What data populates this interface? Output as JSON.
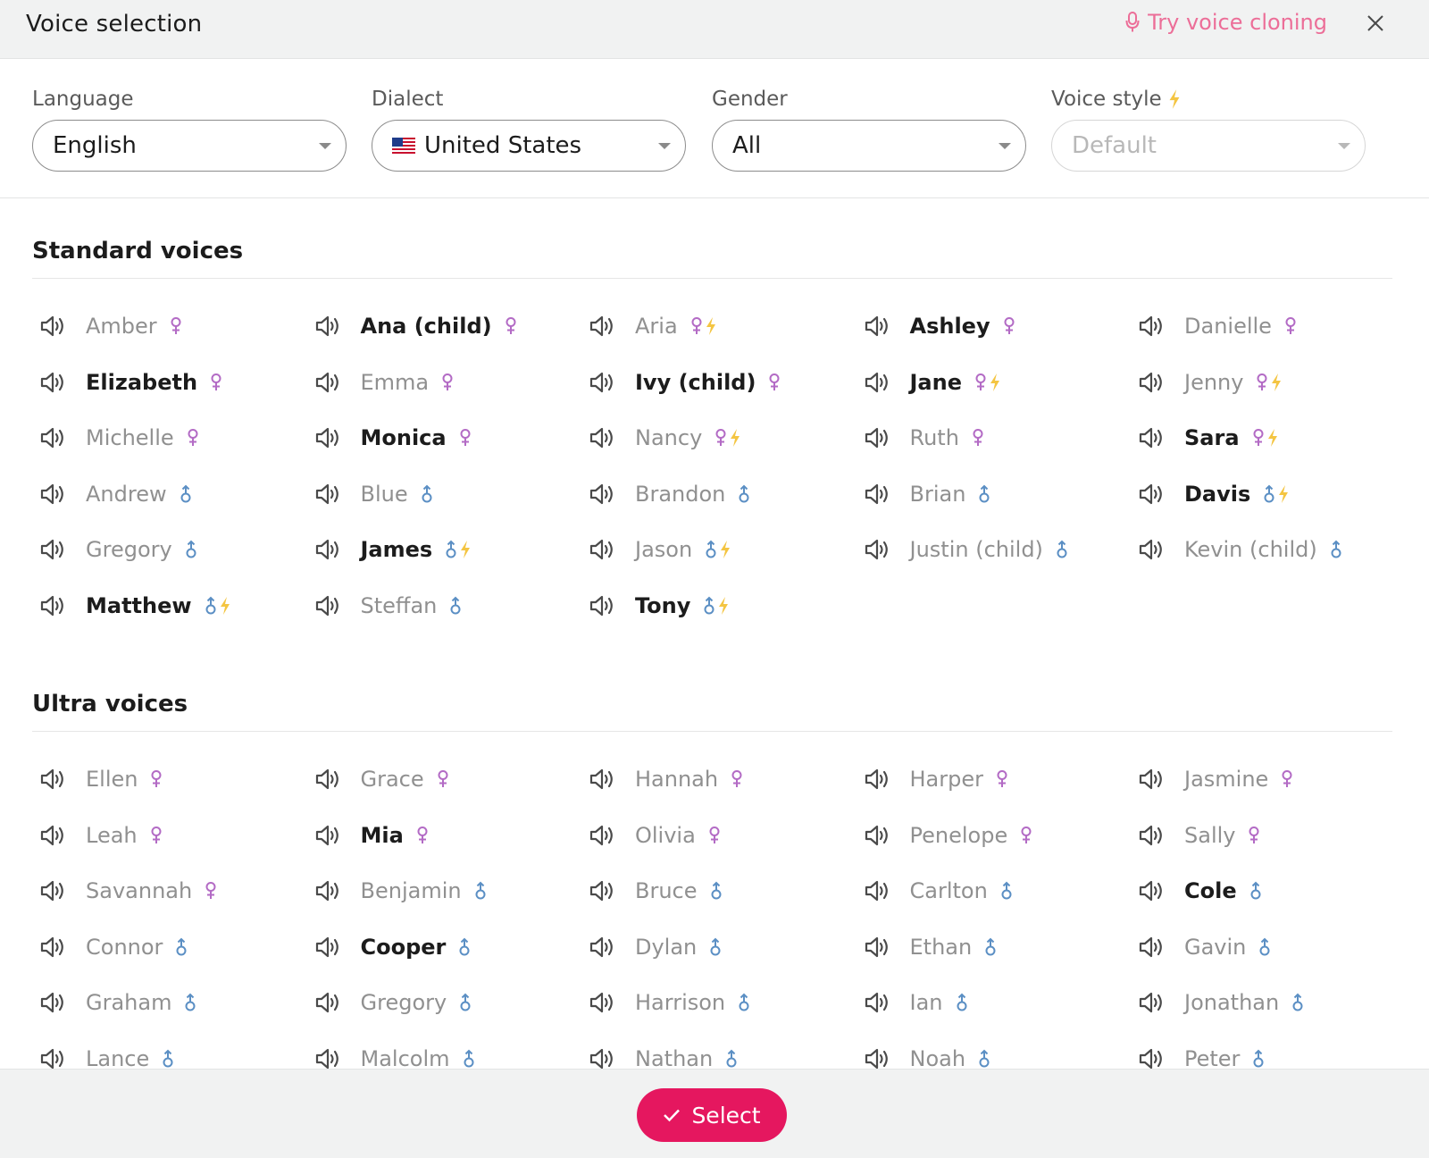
{
  "dialog": {
    "title": "Voice selection",
    "clone_link": "Try voice cloning"
  },
  "filters": {
    "language": {
      "label": "Language",
      "value": "English"
    },
    "dialect": {
      "label": "Dialect",
      "value": "United States"
    },
    "gender": {
      "label": "Gender",
      "value": "All"
    },
    "style": {
      "label": "Voice style",
      "value": "Default",
      "disabled": true
    }
  },
  "sections": [
    {
      "title": "Standard voices",
      "voices": [
        {
          "name": "Amber",
          "gender": "f",
          "style": false,
          "active": false
        },
        {
          "name": "Ana (child)",
          "gender": "f",
          "style": false,
          "active": true
        },
        {
          "name": "Aria",
          "gender": "f",
          "style": true,
          "active": false
        },
        {
          "name": "Ashley",
          "gender": "f",
          "style": false,
          "active": true
        },
        {
          "name": "Danielle",
          "gender": "f",
          "style": false,
          "active": false
        },
        {
          "name": "Elizabeth",
          "gender": "f",
          "style": false,
          "active": true
        },
        {
          "name": "Emma",
          "gender": "f",
          "style": false,
          "active": false
        },
        {
          "name": "Ivy (child)",
          "gender": "f",
          "style": false,
          "active": true
        },
        {
          "name": "Jane",
          "gender": "f",
          "style": true,
          "active": true
        },
        {
          "name": "Jenny",
          "gender": "f",
          "style": true,
          "active": false
        },
        {
          "name": "Michelle",
          "gender": "f",
          "style": false,
          "active": false
        },
        {
          "name": "Monica",
          "gender": "f",
          "style": false,
          "active": true
        },
        {
          "name": "Nancy",
          "gender": "f",
          "style": true,
          "active": false
        },
        {
          "name": "Ruth",
          "gender": "f",
          "style": false,
          "active": false
        },
        {
          "name": "Sara",
          "gender": "f",
          "style": true,
          "active": true
        },
        {
          "name": "Andrew",
          "gender": "m",
          "style": false,
          "active": false
        },
        {
          "name": "Blue",
          "gender": "m",
          "style": false,
          "active": false
        },
        {
          "name": "Brandon",
          "gender": "m",
          "style": false,
          "active": false
        },
        {
          "name": "Brian",
          "gender": "m",
          "style": false,
          "active": false
        },
        {
          "name": "Davis",
          "gender": "m",
          "style": true,
          "active": true
        },
        {
          "name": "Gregory",
          "gender": "m",
          "style": false,
          "active": false
        },
        {
          "name": "James",
          "gender": "m",
          "style": true,
          "active": true
        },
        {
          "name": "Jason",
          "gender": "m",
          "style": true,
          "active": false
        },
        {
          "name": "Justin (child)",
          "gender": "m",
          "style": false,
          "active": false
        },
        {
          "name": "Kevin (child)",
          "gender": "m",
          "style": false,
          "active": false
        },
        {
          "name": "Matthew",
          "gender": "m",
          "style": true,
          "active": true
        },
        {
          "name": "Steffan",
          "gender": "m",
          "style": false,
          "active": false
        },
        {
          "name": "Tony",
          "gender": "m",
          "style": true,
          "active": true
        }
      ]
    },
    {
      "title": "Ultra voices",
      "voices": [
        {
          "name": "Ellen",
          "gender": "f",
          "style": false,
          "active": false
        },
        {
          "name": "Grace",
          "gender": "f",
          "style": false,
          "active": false
        },
        {
          "name": "Hannah",
          "gender": "f",
          "style": false,
          "active": false
        },
        {
          "name": "Harper",
          "gender": "f",
          "style": false,
          "active": false
        },
        {
          "name": "Jasmine",
          "gender": "f",
          "style": false,
          "active": false
        },
        {
          "name": "Leah",
          "gender": "f",
          "style": false,
          "active": false
        },
        {
          "name": "Mia",
          "gender": "f",
          "style": false,
          "active": true
        },
        {
          "name": "Olivia",
          "gender": "f",
          "style": false,
          "active": false
        },
        {
          "name": "Penelope",
          "gender": "f",
          "style": false,
          "active": false
        },
        {
          "name": "Sally",
          "gender": "f",
          "style": false,
          "active": false
        },
        {
          "name": "Savannah",
          "gender": "f",
          "style": false,
          "active": false
        },
        {
          "name": "Benjamin",
          "gender": "m",
          "style": false,
          "active": false
        },
        {
          "name": "Bruce",
          "gender": "m",
          "style": false,
          "active": false
        },
        {
          "name": "Carlton",
          "gender": "m",
          "style": false,
          "active": false
        },
        {
          "name": "Cole",
          "gender": "m",
          "style": false,
          "active": true
        },
        {
          "name": "Connor",
          "gender": "m",
          "style": false,
          "active": false
        },
        {
          "name": "Cooper",
          "gender": "m",
          "style": false,
          "active": true
        },
        {
          "name": "Dylan",
          "gender": "m",
          "style": false,
          "active": false
        },
        {
          "name": "Ethan",
          "gender": "m",
          "style": false,
          "active": false
        },
        {
          "name": "Gavin",
          "gender": "m",
          "style": false,
          "active": false
        },
        {
          "name": "Graham",
          "gender": "m",
          "style": false,
          "active": false
        },
        {
          "name": "Gregory",
          "gender": "m",
          "style": false,
          "active": false
        },
        {
          "name": "Harrison",
          "gender": "m",
          "style": false,
          "active": false
        },
        {
          "name": "Ian",
          "gender": "m",
          "style": false,
          "active": false
        },
        {
          "name": "Jonathan",
          "gender": "m",
          "style": false,
          "active": false
        },
        {
          "name": "Lance",
          "gender": "m",
          "style": false,
          "active": false
        },
        {
          "name": "Malcolm",
          "gender": "m",
          "style": false,
          "active": false
        },
        {
          "name": "Nathan",
          "gender": "m",
          "style": false,
          "active": false
        },
        {
          "name": "Noah",
          "gender": "m",
          "style": false,
          "active": false
        },
        {
          "name": "Peter",
          "gender": "m",
          "style": false,
          "active": false
        }
      ]
    }
  ],
  "footer": {
    "select_label": "Select"
  },
  "colors": {
    "accent": "#e5175f",
    "clone_link": "#ec6e98",
    "female": "#b36bc5",
    "male": "#5b8fc4",
    "bolt": "#f4c542",
    "inactive_text": "#909090",
    "active_text": "#1c1c1c"
  },
  "icons": {
    "speaker": "speaker-icon",
    "female": "female-icon",
    "male": "male-icon",
    "style": "lightning-icon",
    "microphone": "microphone-icon",
    "close": "close-icon",
    "check": "check-icon",
    "flag": "us-flag-icon"
  }
}
